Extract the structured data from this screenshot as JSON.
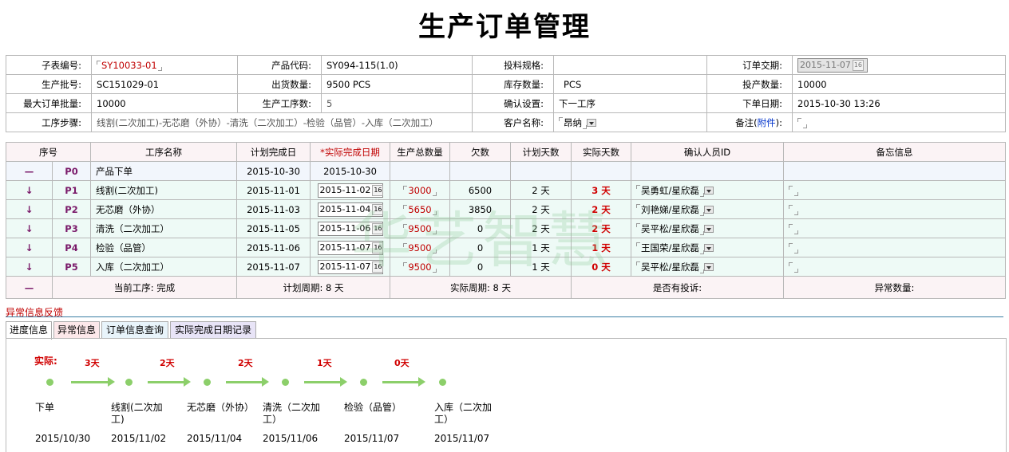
{
  "page_title": "生产订单管理",
  "info": {
    "r1": {
      "l1": "子表编号:",
      "v1": "SY10033-01",
      "l2": "产品代码:",
      "v2": "SY094-115(1.0)",
      "l3": "投料规格:",
      "v3": "",
      "l4": "订单交期:",
      "v4": "2015-11-07"
    },
    "r2": {
      "l1": "生产批号:",
      "v1": "SC151029-01",
      "l2": "出货数量:",
      "v2": "9500 PCS",
      "l3": "库存数量:",
      "v3": "PCS",
      "l4": "投产数量:",
      "v4": "10000"
    },
    "r3": {
      "l1": "最大订单批量:",
      "v1": "10000",
      "l2": "生产工序数:",
      "v2": "5",
      "l3": "确认设置:",
      "v3": "下一工序",
      "l4": "下单日期:",
      "v4": "2015-10-30 13:26"
    },
    "r4": {
      "l1": "工序步骤:",
      "v1": "线割(二次加工)-无芯磨（外协）-清洗（二次加工）-检验（品管）-入库（二次加工）",
      "l3": "客户名称:",
      "v3": "昂纳",
      "l4a": "备注(",
      "l4b": "附件",
      "l4c": "):"
    }
  },
  "calendar_icon": "16",
  "process": {
    "headers": [
      "序号",
      "工序名称",
      "计划完成日",
      "*实际完成日期",
      "生产总数量",
      "欠数",
      "计划天数",
      "实际天数",
      "确认人员ID",
      "备忘信息"
    ],
    "row0": {
      "sym": "—",
      "code": "P0",
      "name": "产品下单",
      "plan": "2015-10-30",
      "actual": "2015-10-30"
    },
    "rows": [
      {
        "code": "P1",
        "name": "线割(二次加工)",
        "plan": "2015-11-01",
        "actual": "2015-11-02",
        "total": "3000",
        "owe": "6500",
        "pdays": "2 天",
        "adays": "3 天",
        "person": "吴勇虹/星欣磊"
      },
      {
        "code": "P2",
        "name": "无芯磨（外协）",
        "plan": "2015-11-03",
        "actual": "2015-11-04",
        "total": "5650",
        "owe": "3850",
        "pdays": "2 天",
        "adays": "2 天",
        "person": "刘艳娣/星欣磊"
      },
      {
        "code": "P3",
        "name": "清洗（二次加工）",
        "plan": "2015-11-05",
        "actual": "2015-11-06",
        "total": "9500",
        "owe": "0",
        "pdays": "2 天",
        "adays": "2 天",
        "person": "吴平松/星欣磊"
      },
      {
        "code": "P4",
        "name": "检验（品管）",
        "plan": "2015-11-06",
        "actual": "2015-11-07",
        "total": "9500",
        "owe": "0",
        "pdays": "1 天",
        "adays": "1 天",
        "person": "王国荣/星欣磊"
      },
      {
        "code": "P5",
        "name": "入库（二次加工）",
        "plan": "2015-11-07",
        "actual": "2015-11-07",
        "total": "9500",
        "owe": "0",
        "pdays": "1 天",
        "adays": "0 天",
        "person": "吴平松/星欣磊"
      }
    ],
    "footer": {
      "sym": "—",
      "current": "当前工序: 完成",
      "plan_cycle": "计划周期: 8 天",
      "actual_cycle": "实际周期: 8 天",
      "complaint": "是否有投诉:",
      "abnormal": "异常数量:"
    }
  },
  "feedback_title": "异常信息反馈",
  "tabs": [
    "进度信息",
    "异常信息",
    "订单信息查询",
    "实际完成日期记录"
  ],
  "progress": {
    "actual_label": "实际:",
    "days": [
      "3天",
      "2天",
      "2天",
      "1天",
      "0天"
    ],
    "steps": [
      {
        "name": "下单",
        "date": "2015/10/30"
      },
      {
        "name": "线割(二次加工)",
        "date": "2015/11/02"
      },
      {
        "name": "无芯磨（外协）",
        "date": "2015/11/04"
      },
      {
        "name": "清洗（二次加工）",
        "date": "2015/11/06"
      },
      {
        "name": "检验（品管）",
        "date": "2015/11/07"
      },
      {
        "name": "入库（二次加工）",
        "date": "2015/11/07"
      }
    ]
  },
  "watermark": "华艺智慧",
  "colors": {
    "accent_red": "#c00000",
    "purple": "#7a1a6a",
    "progress_green": "#8ccf6a",
    "header_pink": "#fbf3f5",
    "row_green": "#eefaf6"
  }
}
